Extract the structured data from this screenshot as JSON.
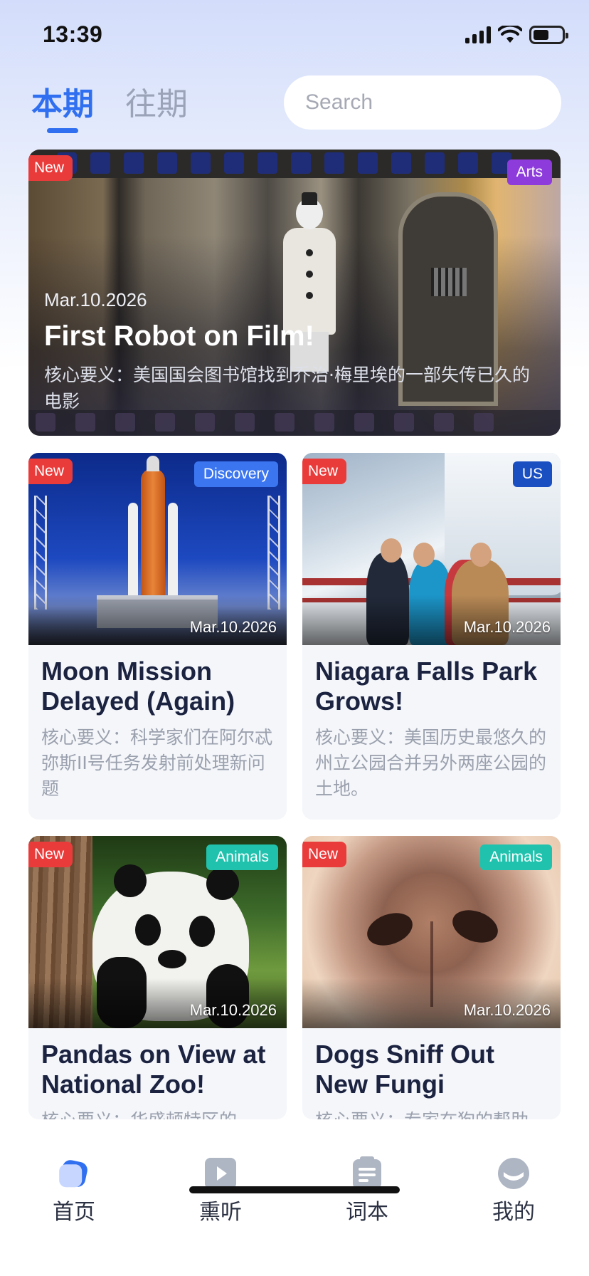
{
  "status_bar": {
    "time": "13:39"
  },
  "header": {
    "tabs": [
      {
        "label": "本期",
        "active": true
      },
      {
        "label": "往期",
        "active": false
      }
    ],
    "search": {
      "placeholder": "Search"
    }
  },
  "featured": {
    "badge_new": "New",
    "category": "Arts",
    "category_color": "#8e3bdc",
    "date": "Mar.10.2026",
    "title": "First Robot on Film!",
    "summary": "核心要义：美国国会图书馆找到乔治·梅里埃的一部失传已久的电影"
  },
  "articles": [
    {
      "badge_new": "New",
      "category": "Discovery",
      "category_color": "#3b76f0",
      "date": "Mar.10.2026",
      "title": "Moon Mission Delayed (Again)",
      "summary": "核心要义：科学家们在阿尔忒弥斯II号任务发射前处理新问题"
    },
    {
      "badge_new": "New",
      "category": "US",
      "category_color": "#1a4fc2",
      "date": "Mar.10.2026",
      "title": "Niagara Falls Park Grows!",
      "summary": "核心要义：美国历史最悠久的州立公园合并另外两座公园的土地。"
    },
    {
      "badge_new": "New",
      "category": "Animals",
      "category_color": "#21c2ad",
      "date": "Mar.10.2026",
      "title": "Pandas on View at National Zoo!",
      "summary": "核心要义：华盛顿特区的"
    },
    {
      "badge_new": "New",
      "category": "Animals",
      "category_color": "#21c2ad",
      "date": "Mar.10.2026",
      "title": "Dogs Sniff Out New Fungi",
      "summary": "核心要义：专家在狗的帮助"
    }
  ],
  "tabbar": {
    "items": [
      {
        "label": "首页",
        "icon": "home-icon",
        "active": true
      },
      {
        "label": "熏听",
        "icon": "play-icon",
        "active": false
      },
      {
        "label": "词本",
        "icon": "notebook-icon",
        "active": false
      },
      {
        "label": "我的",
        "icon": "profile-icon",
        "active": false
      }
    ]
  },
  "colors": {
    "accent": "#2f6ff0",
    "new_badge": "#ea3b3b"
  }
}
